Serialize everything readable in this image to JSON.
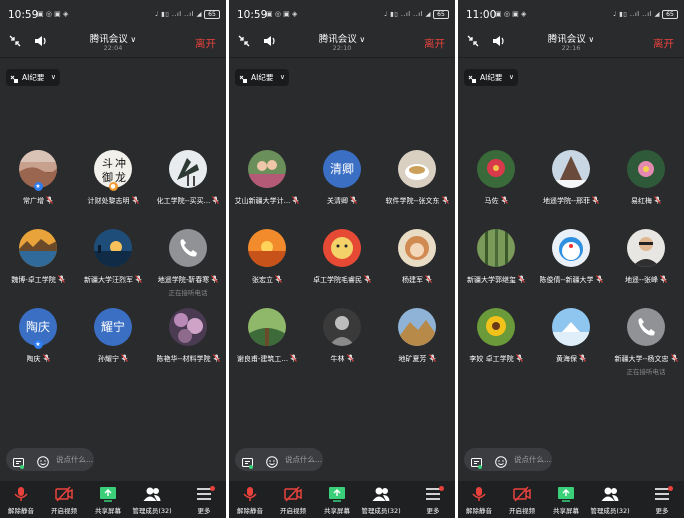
{
  "panels": [
    {
      "status": {
        "time": "10:59",
        "battery": "65"
      },
      "meeting": {
        "title": "腾讯会议",
        "elapsed": "22:04",
        "leave": "离开"
      },
      "ai": {
        "label": "AI纪要"
      },
      "participants": [
        {
          "name": "常广增",
          "avatar": "photo-desert",
          "host": true
        },
        {
          "name": "计财处黎志明",
          "avatar": "photo-calligraphy",
          "badge": "orange"
        },
        {
          "name": "化工学院--买买...",
          "avatar": "photo-crane"
        },
        {
          "name": "魏博-卓工学院",
          "avatar": "photo-lake-sunset"
        },
        {
          "name": "新疆大学汪烈军",
          "avatar": "photo-harbor-sunset"
        },
        {
          "name": "地遥学院-靳春寒",
          "avatar": "phone-icon",
          "status": "正在接听电话"
        },
        {
          "name": "陶庆",
          "avatar": "text",
          "initials": "陶庆",
          "host": true
        },
        {
          "name": "孙耀宁",
          "avatar": "text",
          "initials": "耀宁"
        },
        {
          "name": "陈艳华--材料学院",
          "avatar": "photo-flowers"
        }
      ],
      "chat_placeholder": "说点什么...",
      "page": 0
    },
    {
      "status": {
        "time": "10:59",
        "battery": "65"
      },
      "meeting": {
        "title": "腾讯会议",
        "elapsed": "22:10",
        "leave": "离开"
      },
      "ai": {
        "label": "AI纪要"
      },
      "participants": [
        {
          "name": "艾山新疆大学计...",
          "avatar": "photo-couple"
        },
        {
          "name": "关清卿",
          "avatar": "text",
          "initials": "清卿"
        },
        {
          "name": "软件学院--张文东",
          "avatar": "photo-tea"
        },
        {
          "name": "张宏立",
          "avatar": "photo-sunset-water"
        },
        {
          "name": "卓工学院毛睿民",
          "avatar": "photo-cartoon"
        },
        {
          "name": "杨建军",
          "avatar": "photo-monkey"
        },
        {
          "name": "谢良甫-建筑工...",
          "avatar": "photo-forest"
        },
        {
          "name": "牛林",
          "avatar": "photo-man-bw"
        },
        {
          "name": "地矿夏芳",
          "avatar": "photo-mountain"
        }
      ],
      "chat_placeholder": "说点什么...",
      "page": 1
    },
    {
      "status": {
        "time": "11:00",
        "battery": "65"
      },
      "meeting": {
        "title": "腾讯会议",
        "elapsed": "22:16",
        "leave": "离开"
      },
      "ai": {
        "label": "AI纪要"
      },
      "participants": [
        {
          "name": "马佐",
          "avatar": "photo-flower-red"
        },
        {
          "name": "地遥学院--邢菲",
          "avatar": "photo-snow-tree"
        },
        {
          "name": "易红梅",
          "avatar": "photo-lotus"
        },
        {
          "name": "新疆大学郭继玺",
          "avatar": "photo-bamboo"
        },
        {
          "name": "陈俊倩--新疆大学",
          "avatar": "photo-doraemon"
        },
        {
          "name": "地遥--张峰",
          "avatar": "photo-man-glasses"
        },
        {
          "name": "李姣 卓工学院",
          "avatar": "photo-sunflower"
        },
        {
          "name": "黄海保",
          "avatar": "photo-sky-ice"
        },
        {
          "name": "新疆大学--杨文忠",
          "avatar": "phone-icon",
          "status": "正在接听电话"
        }
      ],
      "chat_placeholder": "说点什么...",
      "page": 2
    }
  ],
  "toolbar": [
    {
      "label": "解除静音",
      "icon": "mic-off-icon"
    },
    {
      "label": "开启视频",
      "icon": "video-off-icon"
    },
    {
      "label": "共享屏幕",
      "icon": "share-screen-icon"
    },
    {
      "label": "管理成员(32)",
      "icon": "members-icon"
    },
    {
      "label": "更多",
      "icon": "more-icon"
    }
  ],
  "colors": {
    "background": "#2a2b2d",
    "toolbar": "#1f2022",
    "leave": "#e9423d",
    "avatar_text_bg": "#3a6fc4",
    "mic_muted": "#e9423d"
  }
}
